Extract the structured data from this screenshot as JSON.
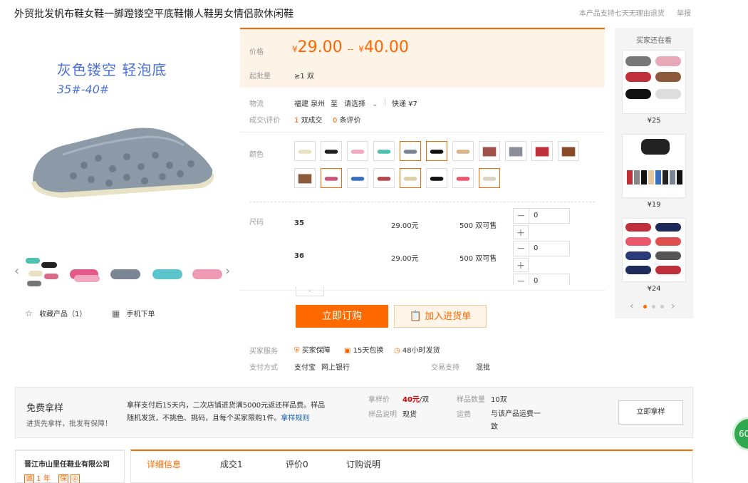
{
  "title": "外贸批发帆布鞋女鞋一脚蹬镂空平底鞋懒人鞋男女情侣款休闲鞋",
  "top_links": {
    "support": "本产品支持七天无理由退货",
    "report": "举报"
  },
  "gallery": {
    "overlay_line1": "灰色镂空   轻泡底",
    "overlay_line2": "35#-40#",
    "prev_arrow": "‹",
    "next_arrow": "›"
  },
  "actions": {
    "favorite": "收藏产品（1）",
    "mobile_order": "手机下单"
  },
  "price": {
    "label": "价格",
    "currency": "¥",
    "low": "29.00",
    "sep": "--",
    "high": "40.00",
    "moq_label": "起批量",
    "moq_value": "≥1 双"
  },
  "logistics": {
    "label": "物流",
    "from": "福建 泉州",
    "to_word": "至",
    "select": "请选择",
    "express": "快递 ¥7"
  },
  "deals": {
    "label": "成交\\评价",
    "deals_count": "1",
    "deals_text": "双成交",
    "reviews_count": "0",
    "reviews_text": "条评价"
  },
  "color": {
    "label": "颜色"
  },
  "sizes": {
    "label": "尺码",
    "rows": [
      {
        "size": "35",
        "price": "29.00元",
        "stock": "500 双可售",
        "qty": "0"
      },
      {
        "size": "36",
        "price": "29.00元",
        "stock": "500 双可售",
        "qty": "0"
      },
      {
        "size": "",
        "price": "",
        "stock": "",
        "qty": "0"
      }
    ]
  },
  "buttons": {
    "order": "立即订购",
    "cart": "加入进货单"
  },
  "services": {
    "label": "买家服务",
    "items": [
      "买家保障",
      "15天包换",
      "48小时发货"
    ],
    "pay_label": "支付方式",
    "pay_items": [
      "支付宝",
      "网上银行"
    ],
    "trade_label": "交易支持",
    "trade_value": "混批"
  },
  "sidebar": {
    "title": "买家还在看",
    "items": [
      {
        "price": "¥25"
      },
      {
        "price": "¥19"
      },
      {
        "price": "¥24"
      }
    ],
    "prev": "‹",
    "next": "›"
  },
  "sample": {
    "title": "免费拿样",
    "subtitle": "进货先拿样，批发有保障！",
    "desc": "拿样支付后15天内，二次店铺进货满5000元返还样品费。样品随机发货，不挑色、挑码，且每个买家限购1件。",
    "rule_link": "拿样规则",
    "price_label": "拿样价",
    "price_value": "40元",
    "price_unit": "/双",
    "desc_label": "样品说明",
    "desc_value": "现货",
    "qty_label": "样品数量",
    "qty_value": "10双",
    "ship_label": "运费",
    "ship_value": "与该产品运费一致",
    "btn": "立即拿样"
  },
  "company": {
    "name": "晋江市山里任鞋业有限公司",
    "years": "1 年"
  },
  "tabs": [
    "详细信息",
    "成交1",
    "评价0",
    "订购说明"
  ],
  "float_badge": "60",
  "colors": {
    "accent": "#ff6a00",
    "price_bg": "#fef3e7"
  }
}
